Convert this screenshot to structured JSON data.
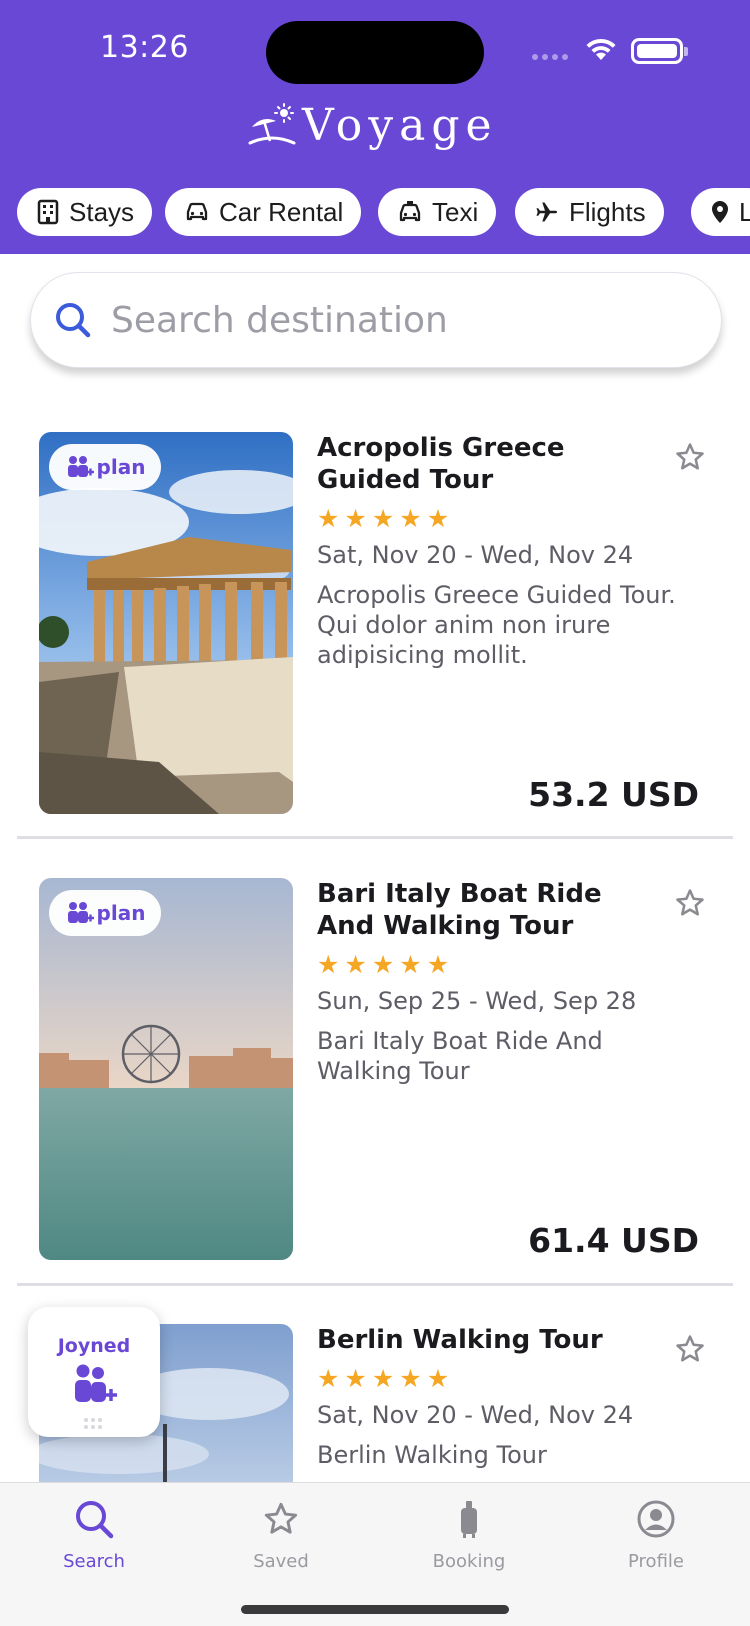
{
  "status_bar": {
    "time": "13:26"
  },
  "app": {
    "name": "Voyage"
  },
  "categories": [
    {
      "label": "Stays",
      "icon": "building-icon"
    },
    {
      "label": "Car Rental",
      "icon": "car-icon"
    },
    {
      "label": "Texi",
      "icon": "taxi-icon"
    },
    {
      "label": "Flights",
      "icon": "airplane-icon"
    },
    {
      "label": "L",
      "icon": "location-pin-icon"
    }
  ],
  "search": {
    "placeholder": "Search destination",
    "value": ""
  },
  "plan_badge_label": "plan",
  "tours": [
    {
      "title": "Acropolis Greece Guided Tour",
      "rating": 5,
      "dates": "Sat, Nov 20 - Wed, Nov 24",
      "description": "Acropolis Greece Guided Tour. Qui dolor anim non irure adipisicing mollit.",
      "price": "53.2 USD"
    },
    {
      "title": "Bari Italy Boat Ride And Walking Tour",
      "rating": 5,
      "dates": "Sun, Sep 25 - Wed, Sep 28",
      "description": "Bari Italy Boat Ride And Walking Tour",
      "price": "61.4 USD"
    },
    {
      "title": "Berlin Walking Tour",
      "rating": 5,
      "dates": "Sat, Nov 20 - Wed, Nov 24",
      "description": "Berlin Walking Tour"
    }
  ],
  "joyned_widget": {
    "label": "Joyned"
  },
  "tab_bar": {
    "items": [
      {
        "label": "Search",
        "icon": "search-icon",
        "active": true
      },
      {
        "label": "Saved",
        "icon": "star-icon",
        "active": false
      },
      {
        "label": "Booking",
        "icon": "luggage-icon",
        "active": false
      },
      {
        "label": "Profile",
        "icon": "profile-icon",
        "active": false
      }
    ]
  },
  "colors": {
    "brand": "#6a48d6",
    "star": "#f5a623",
    "text_primary": "#1b1b1f",
    "text_secondary": "#5d5d66"
  }
}
